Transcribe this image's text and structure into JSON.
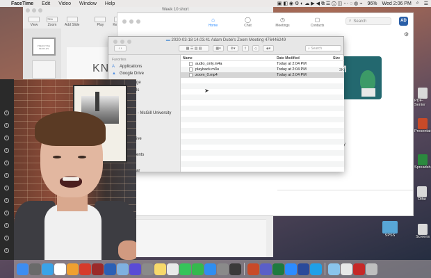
{
  "menubar": {
    "app_name": "FaceTime",
    "items": [
      "Edit",
      "Video",
      "Window",
      "Help"
    ],
    "battery": "96%",
    "clock": "Wed 2:06 PM"
  },
  "keynote": {
    "title": "Week 10 short",
    "toolbar": [
      "View",
      "Zoom",
      "Add Slide",
      "Play",
      "Keynote"
    ],
    "zoom_value": "75%",
    "slide_thumb_text": "PREDICTING PEOPLE'S",
    "canvas_text": "KN"
  },
  "zoom_app": {
    "nav": [
      {
        "label": "Home",
        "icon": "home-icon"
      },
      {
        "label": "Chat",
        "icon": "chat-icon"
      },
      {
        "label": "Meetings",
        "icon": "clock-icon"
      },
      {
        "label": "Contacts",
        "icon": "contacts-icon"
      }
    ],
    "search_placeholder": "Search",
    "avatar_initials": "AD",
    "card_letter": "M",
    "today_text": "oday"
  },
  "finder": {
    "title": "2020-03-18 14.03.41 Adam Dubé's Zoom Meeting 476446249",
    "search_placeholder": "Search",
    "sidebar_header": "Favorites",
    "sidebar_items": [
      {
        "label": "Applications",
        "icon": "applications-icon"
      },
      {
        "label": "Google Drive",
        "icon": "drive-icon"
      }
    ],
    "partial_sidebar_fragments": [
      "ge",
      "ls",
      "- McGill University",
      "ive",
      "ents",
      "ar"
    ],
    "columns": {
      "name": "Name",
      "date": "Date Modified",
      "size": "Size"
    },
    "rows": [
      {
        "name": "audio_only.m4a",
        "date": "Today at 2:04 PM",
        "size": "",
        "selected": false
      },
      {
        "name": "playback.m3u",
        "date": "Today at 2:04 PM",
        "size": "",
        "selected": false
      },
      {
        "name": "zoom_0.mp4",
        "date": "Today at 2:04 PM",
        "size": "",
        "selected": true
      }
    ],
    "size_fragment": "3K"
  },
  "desktop_icons": [
    {
      "label": "PDF-Senior",
      "color": "#d9d9d9"
    },
    {
      "label": "Presentat",
      "color": "#c94a28"
    },
    {
      "label": "Spreadsh",
      "color": "#2b8a3e"
    },
    {
      "label": "Othe",
      "color": "#d9d9d9"
    },
    {
      "label": "SPSS",
      "color": "#58a6d6"
    },
    {
      "label": "Screens",
      "color": "#d9d9d9"
    }
  ],
  "dock_apps": [
    {
      "name": "finder-icon",
      "color": "#3d8df0"
    },
    {
      "name": "launchpad-icon",
      "color": "#6a6a6a"
    },
    {
      "name": "safari-icon",
      "color": "#3aa3e8"
    },
    {
      "name": "calendar-icon",
      "color": "#ffffff"
    },
    {
      "name": "photos-icon",
      "color": "#f0a030"
    },
    {
      "name": "papers-icon",
      "color": "#d63b2b"
    },
    {
      "name": "mendeley-icon",
      "color": "#9b2a2a"
    },
    {
      "name": "word-icon",
      "color": "#2b5fb5"
    },
    {
      "name": "preview-icon",
      "color": "#7fb0e0"
    },
    {
      "name": "siri-icon",
      "color": "#5a4bd6"
    },
    {
      "name": "rocket-icon",
      "color": "#8a8a8a"
    },
    {
      "name": "notes-icon",
      "color": "#f7d96b"
    },
    {
      "name": "stickies-icon",
      "color": "#e9e9e9"
    },
    {
      "name": "messages-icon",
      "color": "#36c45a"
    },
    {
      "name": "facetime-icon",
      "color": "#35b84e"
    },
    {
      "name": "appstore-icon",
      "color": "#2f8ef0"
    },
    {
      "name": "settings-icon",
      "color": "#8a8a8a"
    },
    {
      "name": "quicktime-icon",
      "color": "#3a3a3a"
    },
    {
      "name": "powerpoint-icon",
      "color": "#c94a28"
    },
    {
      "name": "teams-icon",
      "color": "#5b5fc7"
    },
    {
      "name": "excel-icon",
      "color": "#1f7a3f"
    },
    {
      "name": "zoom-icon",
      "color": "#2d8cff"
    },
    {
      "name": "camera-icon",
      "color": "#2a4a9a"
    },
    {
      "name": "skype-icon",
      "color": "#1fa0e8"
    },
    {
      "name": "folder-icon",
      "color": "#8ac4ec"
    },
    {
      "name": "document-icon",
      "color": "#e8e8e8"
    },
    {
      "name": "pdf-icon",
      "color": "#c62828"
    },
    {
      "name": "trash-icon",
      "color": "#bfbfbf"
    }
  ]
}
